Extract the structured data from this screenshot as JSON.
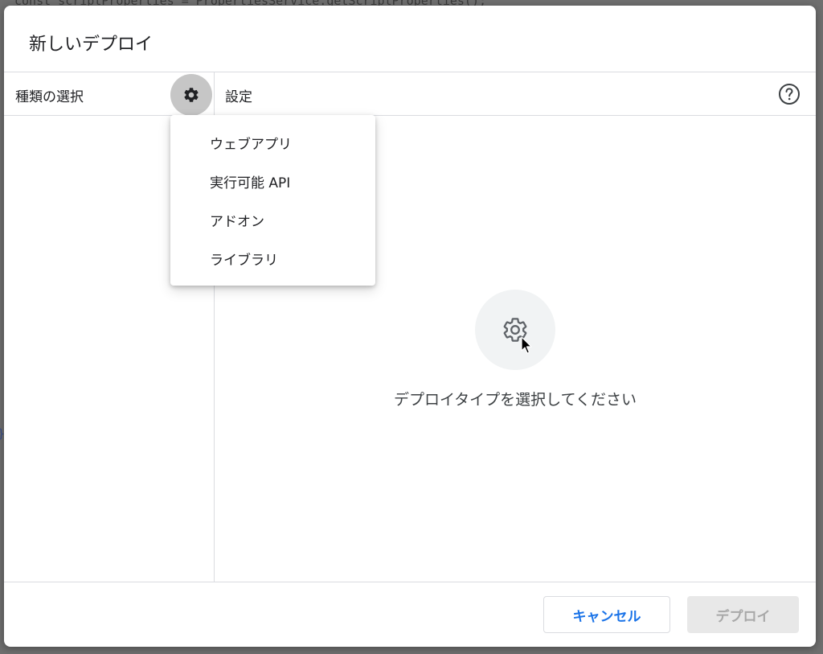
{
  "background": {
    "code_line": "const scriptProperties = PropertiesService.getScriptProperties();",
    "brace": "}"
  },
  "dialog": {
    "title": "新しいデプロイ",
    "left_panel": {
      "title": "種類の選択",
      "gear_icon": "gear-icon"
    },
    "right_panel": {
      "title": "設定",
      "help_icon": "help-circle-icon"
    },
    "dropdown": {
      "items": [
        {
          "label": "ウェブアプリ"
        },
        {
          "label": "実行可能 API"
        },
        {
          "label": "アドオン"
        },
        {
          "label": "ライブラリ"
        }
      ]
    },
    "empty_state": {
      "icon": "gear-icon",
      "message": "デプロイタイプを選択してください"
    },
    "footer": {
      "cancel_label": "キャンセル",
      "deploy_label": "デプロイ",
      "deploy_disabled": true
    }
  },
  "colors": {
    "accent": "#1a73e8",
    "backdrop": "#6f6f6f",
    "disabled_bg": "#e8e8e8",
    "disabled_text": "#a8a8a8"
  }
}
